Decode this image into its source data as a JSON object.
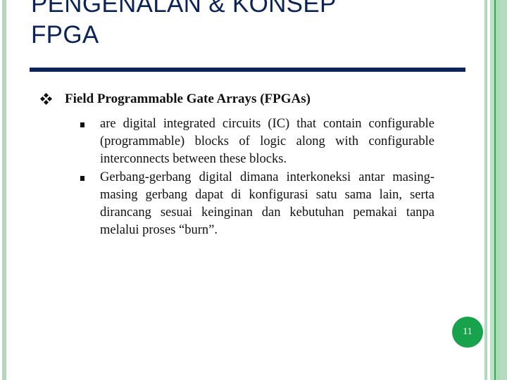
{
  "slide": {
    "title": "PENGENALAN & KONSEP FPGA",
    "title_line1": "PENGENALAN & KONSEP",
    "title_line2": "FPGA",
    "heading": "Field Programmable Gate Arrays (FPGAs)",
    "bullets": [
      "are digital integrated circuits (IC) that contain configurable (programmable) blocks of logic along with configurable interconnects between these blocks.",
      "Gerbang-gerbang digital dimana interkoneksi antar masing-masing gerbang dapat di konfigurasi satu sama lain, serta dirancang sesuai keinginan dan kebutuhan pemakai tanpa melalui proses “burn”."
    ],
    "page_number": "11"
  },
  "icons": {
    "heading_bullet": "four-diamond-bullet-icon",
    "sub_bullet": "square-bullet-icon"
  },
  "colors": {
    "title": "#0d2458",
    "rule": "#0d2458",
    "accent_green": "#17a24b",
    "stripe_green": "#b3d7bd"
  }
}
